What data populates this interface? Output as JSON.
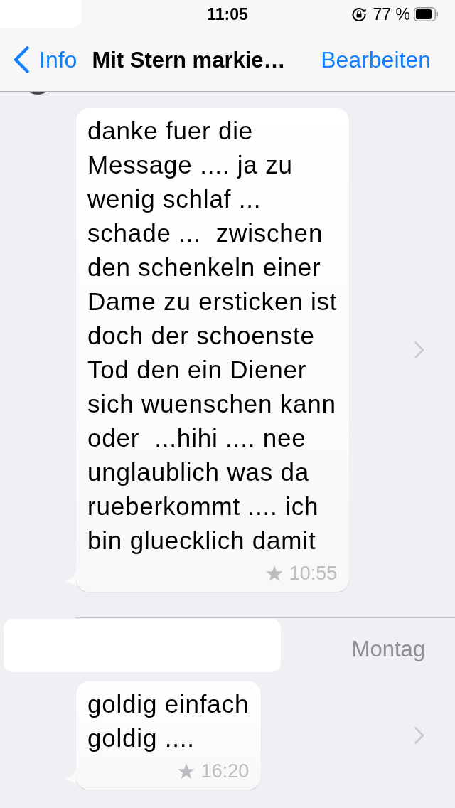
{
  "status_bar": {
    "time": "11:05",
    "battery_percent": "77 %"
  },
  "nav_bar": {
    "back_label": "Info",
    "title": "Mit Stern markie…",
    "edit_label": "Bearbeiten"
  },
  "messages": [
    {
      "text": "danke fuer die\nMessage .... ja zu\nwenig schlaf ...\nschade ...  zwischen\nden schenkeln einer\nDame zu ersticken ist\ndoch der schoenste\nTod den ein Diener\nsich wuenschen kann\noder  ...hihi .... nee\nunglaublich was da\nrueberkommt .... ich\nbin gluecklich damit",
      "starred": true,
      "time": "10:55"
    },
    {
      "date": "Montag",
      "text": "goldig einfach\ngoldig ....",
      "starred": true,
      "time": "16:20"
    }
  ]
}
